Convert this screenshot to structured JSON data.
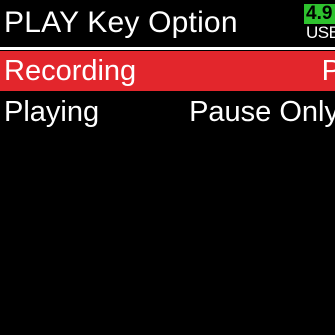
{
  "header": {
    "title": "PLAY Key Option",
    "battery_level": "4.9",
    "power_source": "USB"
  },
  "colors": {
    "selected_row": "#e3262c",
    "battery_fill": "#2ec22e",
    "background": "#000000",
    "text": "#ffffff"
  },
  "menu": {
    "items": [
      {
        "label": "Recording",
        "value": "P",
        "selected": true
      },
      {
        "label": "Playing",
        "value": "Pause Only",
        "selected": false
      }
    ]
  }
}
